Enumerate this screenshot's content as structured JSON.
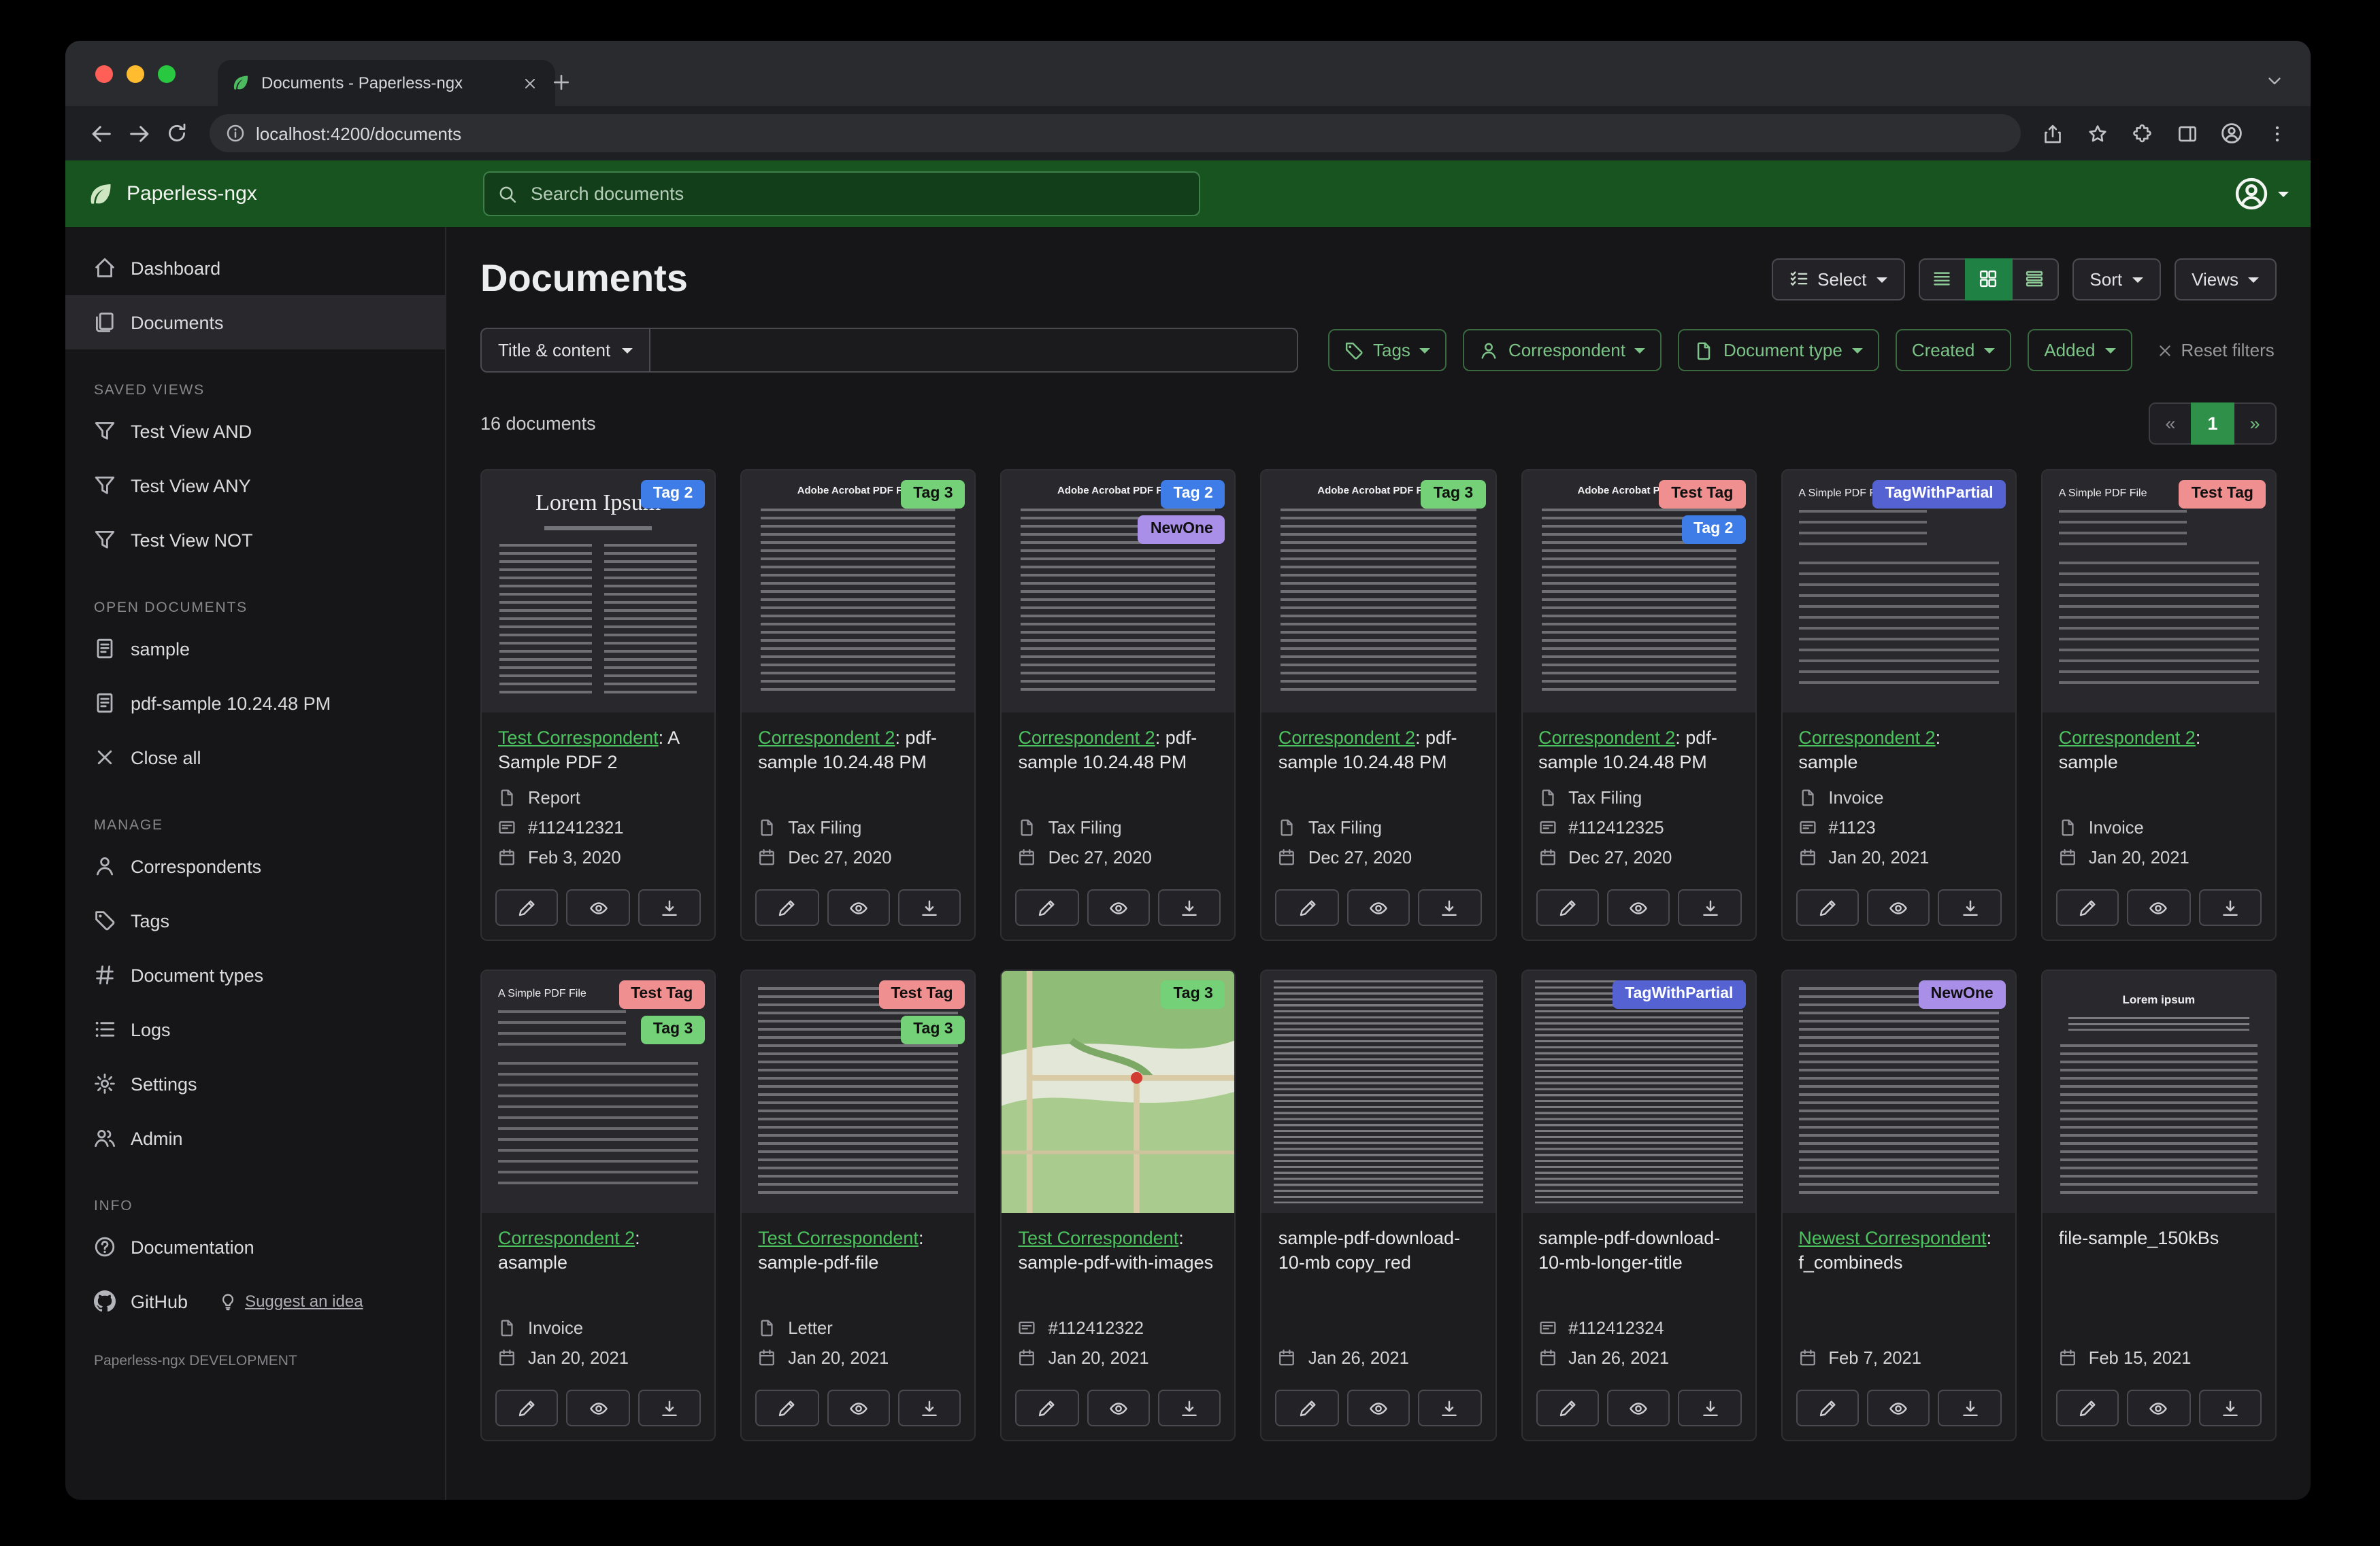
{
  "browser": {
    "tab_title": "Documents - Paperless-ngx",
    "url": "localhost:4200/documents"
  },
  "app_header": {
    "brand": "Paperless-ngx",
    "search_placeholder": "Search documents"
  },
  "sidebar": {
    "primary": [
      {
        "icon": "house",
        "label": "Dashboard",
        "active": false
      },
      {
        "icon": "files",
        "label": "Documents",
        "active": true
      }
    ],
    "sections": [
      {
        "title": "SAVED VIEWS",
        "items": [
          {
            "icon": "funnel",
            "label": "Test View AND"
          },
          {
            "icon": "funnel",
            "label": "Test View ANY"
          },
          {
            "icon": "funnel",
            "label": "Test View NOT"
          }
        ]
      },
      {
        "title": "OPEN DOCUMENTS",
        "items": [
          {
            "icon": "file-text",
            "label": "sample"
          },
          {
            "icon": "file-text",
            "label": "pdf-sample 10.24.48 PM"
          },
          {
            "icon": "x",
            "label": "Close all"
          }
        ]
      },
      {
        "title": "MANAGE",
        "items": [
          {
            "icon": "person",
            "label": "Correspondents"
          },
          {
            "icon": "tag",
            "label": "Tags"
          },
          {
            "icon": "hash",
            "label": "Document types"
          },
          {
            "icon": "list",
            "label": "Logs"
          },
          {
            "icon": "gear",
            "label": "Settings"
          },
          {
            "icon": "people",
            "label": "Admin"
          }
        ]
      },
      {
        "title": "INFO",
        "items": [
          {
            "icon": "question",
            "label": "Documentation"
          },
          {
            "icon": "github",
            "label": "GitHub",
            "extra": {
              "icon": "bulb",
              "label": "Suggest an idea"
            }
          }
        ]
      }
    ],
    "footer": "Paperless-ngx DEVELOPMENT"
  },
  "page": {
    "title": "Documents",
    "select_label": "Select",
    "sort_label": "Sort",
    "views_label": "Views",
    "count": "16 documents",
    "pagination": [
      "«",
      "1",
      "»"
    ]
  },
  "filters": {
    "field": "Title & content",
    "buttons": [
      {
        "icon": "tag",
        "label": "Tags"
      },
      {
        "icon": "person",
        "label": "Correspondent"
      },
      {
        "icon": "file",
        "label": "Document type"
      },
      {
        "icon": null,
        "label": "Created"
      },
      {
        "icon": null,
        "label": "Added"
      }
    ],
    "reset": "Reset filters"
  },
  "colors": {
    "accent_green": "#4cc35e",
    "header_green": "#17541f",
    "tags": {
      "Tag 2": {
        "bg": "#3e7de8",
        "fg": "#ffffff"
      },
      "Tag 3": {
        "bg": "#74d178",
        "fg": "#101010"
      },
      "NewOne": {
        "bg": "#a98fe8",
        "fg": "#101010"
      },
      "Test Tag": {
        "bg": "#ef8f8f",
        "fg": "#101010"
      },
      "TagWithPartial": {
        "bg": "#5563d2",
        "fg": "#ffffff"
      }
    }
  },
  "documents": [
    {
      "thumb": {
        "variant": "serif",
        "title": "Lorem Ipsum"
      },
      "tags": [
        "Tag 2"
      ],
      "correspondent": "Test Correspondent",
      "title_suffix": ": A Sample PDF 2",
      "doc_type": "Report",
      "asn": "#112412321",
      "date": "Feb 3, 2020"
    },
    {
      "thumb": {
        "variant": "adobe",
        "title": "Adobe Acrobat PDF Files"
      },
      "tags": [
        "Tag 3"
      ],
      "correspondent": "Correspondent 2",
      "title_suffix": ": pdf-sample 10.24.48 PM",
      "doc_type": "Tax Filing",
      "date": "Dec 27, 2020"
    },
    {
      "thumb": {
        "variant": "adobe",
        "title": "Adobe Acrobat PDF Files"
      },
      "tags": [
        "Tag 2",
        "NewOne"
      ],
      "correspondent": "Correspondent 2",
      "title_suffix": ": pdf-sample 10.24.48 PM",
      "doc_type": "Tax Filing",
      "date": "Dec 27, 2020"
    },
    {
      "thumb": {
        "variant": "adobe",
        "title": "Adobe Acrobat PDF Files"
      },
      "tags": [
        "Tag 3"
      ],
      "correspondent": "Correspondent 2",
      "title_suffix": ": pdf-sample 10.24.48 PM",
      "doc_type": "Tax Filing",
      "date": "Dec 27, 2020"
    },
    {
      "thumb": {
        "variant": "adobe",
        "title": "Adobe Acrobat PDF Files"
      },
      "tags": [
        "Test Tag",
        "Tag 2"
      ],
      "correspondent": "Correspondent 2",
      "title_suffix": ": pdf-sample 10.24.48 PM",
      "doc_type": "Tax Filing",
      "asn": "#112412325",
      "date": "Dec 27, 2020"
    },
    {
      "thumb": {
        "variant": "simple",
        "title": "A Simple PDF File"
      },
      "tags": [
        "TagWithPartial"
      ],
      "correspondent": "Correspondent 2",
      "title_suffix": ": sample",
      "doc_type": "Invoice",
      "asn": "#1123",
      "date": "Jan 20, 2021"
    },
    {
      "thumb": {
        "variant": "simple",
        "title": "A Simple PDF File"
      },
      "tags": [
        "Test Tag"
      ],
      "correspondent": "Correspondent 2",
      "title_suffix": ": sample",
      "doc_type": "Invoice",
      "date": "Jan 20, 2021"
    },
    {
      "thumb": {
        "variant": "simple",
        "title": "A Simple PDF File"
      },
      "tags": [
        "Test Tag",
        "Tag 3"
      ],
      "correspondent": "Correspondent 2",
      "title_suffix": ": asample",
      "doc_type": "Invoice",
      "date": "Jan 20, 2021"
    },
    {
      "thumb": {
        "variant": "text",
        "title": ""
      },
      "tags": [
        "Test Tag",
        "Tag 3"
      ],
      "correspondent": "Test Correspondent",
      "title_suffix": ": sample-pdf-file",
      "doc_type": "Letter",
      "date": "Jan 20, 2021"
    },
    {
      "thumb": {
        "variant": "map",
        "title": ""
      },
      "tags": [
        "Tag 3"
      ],
      "correspondent": "Test Correspondent",
      "title_suffix": ": sample-pdf-with-images",
      "asn": "#112412322",
      "date": "Jan 20, 2021"
    },
    {
      "thumb": {
        "variant": "dense",
        "title": ""
      },
      "tags": [],
      "plain_title": "sample-pdf-download-10-mb copy_red",
      "date": "Jan 26, 2021"
    },
    {
      "thumb": {
        "variant": "dense",
        "title": ""
      },
      "tags": [
        "TagWithPartial"
      ],
      "plain_title": "sample-pdf-download-10-mb-longer-title",
      "asn": "#112412324",
      "date": "Jan 26, 2021"
    },
    {
      "thumb": {
        "variant": "text",
        "title": ""
      },
      "tags": [
        "NewOne"
      ],
      "correspondent": "Newest Correspondent",
      "title_suffix": ": f_combineds",
      "date": "Feb 7, 2021"
    },
    {
      "thumb": {
        "variant": "lorem2",
        "title": "Lorem ipsum"
      },
      "tags": [],
      "plain_title": "file-sample_150kBs",
      "date": "Feb 15, 2021"
    }
  ]
}
